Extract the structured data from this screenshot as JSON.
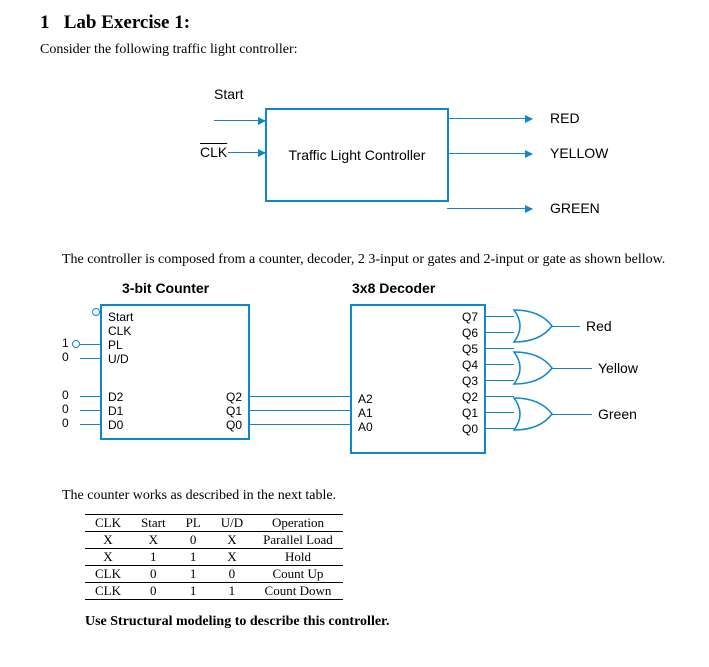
{
  "heading": {
    "num": "1",
    "title": "Lab Exercise 1:"
  },
  "intro": "Consider the following traffic light controller:",
  "d1": {
    "start": "Start",
    "clk": "CLK",
    "controller": "Traffic Light Controller",
    "red": "RED",
    "yellow": "YELLOW",
    "green": "GREEN"
  },
  "para1": "The controller is composed from a counter, decoder, 2 3-input or gates and 2-input or gate as shown bellow.",
  "d2": {
    "counterTitle": "3-bit Counter",
    "decoderTitle": "3x8 Decoder",
    "start": "Start",
    "clk": "CLK",
    "pl": "PL",
    "ud": "U/D",
    "d2p": "D2",
    "d1p": "D1",
    "d0p": "D0",
    "q2": "Q2",
    "q1": "Q1",
    "q0": "Q0",
    "a2": "A2",
    "a1": "A1",
    "a0": "A0",
    "dq7": "Q7",
    "dq6": "Q6",
    "dq5": "Q5",
    "dq4": "Q4",
    "dq3": "Q3",
    "dq2": "Q2",
    "dq1": "Q1",
    "dq0": "Q0",
    "one": "1",
    "zero": "0",
    "red": "Red",
    "yellow": "Yellow",
    "green": "Green"
  },
  "para2": "The counter works as described in the next table.",
  "table": {
    "head": [
      "CLK",
      "Start",
      "PL",
      "U/D",
      "Operation"
    ],
    "rows": [
      [
        "X",
        "X",
        "0",
        "X",
        "Parallel Load"
      ],
      [
        "X",
        "1",
        "1",
        "X",
        "Hold"
      ],
      [
        "CLK",
        "0",
        "1",
        "0",
        "Count Up"
      ],
      [
        "CLK",
        "0",
        "1",
        "1",
        "Count Down"
      ]
    ]
  },
  "final": "Use Structural modeling to describe this controller."
}
